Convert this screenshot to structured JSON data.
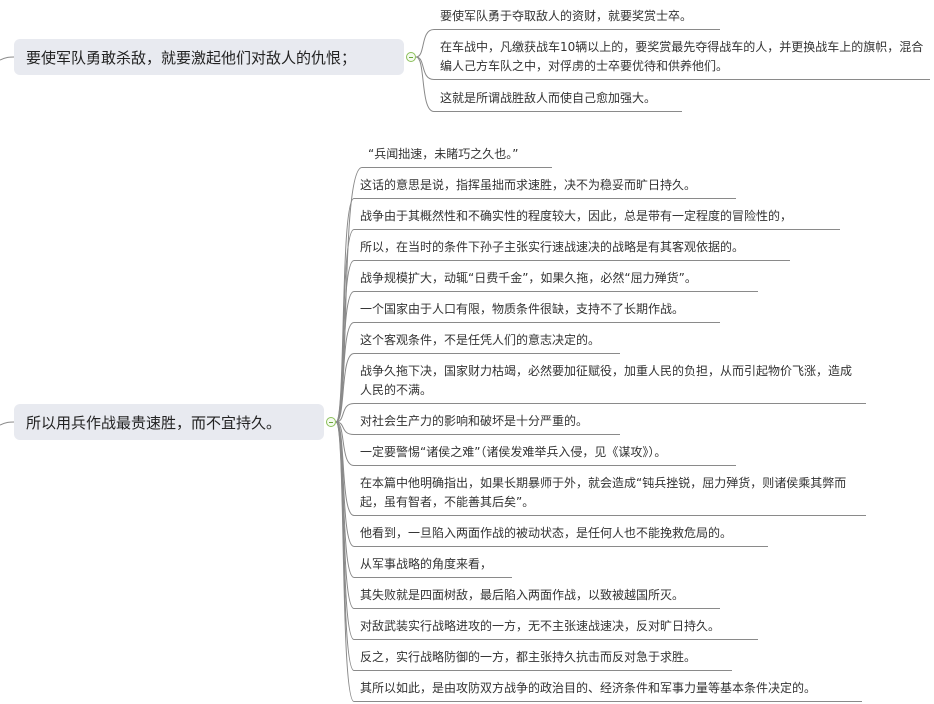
{
  "branches": [
    {
      "topic": "要使军队勇敢杀敌，就要激起他们对敌人的仇恨；",
      "leaves": [
        "要使军队勇于夺取敌人的资财，就要奖赏士卒。",
        "在车战中，凡缴获战车10辆以上的，要奖赏最先夺得战车的人，并更换战车上的旗帜，混合编人己方车队之中，对俘虏的士卒要优待和供养他们。",
        "这就是所谓战胜敌人而使自己愈加强大。"
      ]
    },
    {
      "topic": "所以用兵作战最贵速胜，而不宜持久。",
      "leaves": [
        "“兵闻拙速，未睹巧之久也。”",
        "这话的意思是说，指挥虽拙而求速胜，决不为稳妥而旷日持久。",
        "战争由于其概然性和不确实性的程度较大，因此，总是带有一定程度的冒险性的，",
        "所以，在当时的条件下孙子主张实行速战速决的战略是有其客观依据的。",
        "战争规模扩大，动辄“日费千金”，如果久拖，必然“屈力殚货”。",
        "一个国家由于人口有限，物质条件很缺，支持不了长期作战。",
        "这个客观条件，不是任凭人们的意志决定的。",
        "战争久拖下决，国家财力枯竭，必然要加征赋役，加重人民的负担，从而引起物价飞涨，造成人民的不满。",
        "对社会生产力的影响和破坏是十分严重的。",
        "一定要警惕“诸侯之难”（诸侯发难举兵入侵，见《谋攻》）。",
        "在本篇中他明确指出，如果长期暴师于外，就会造成“钝兵挫锐，屈力殚货，则诸侯乘其弊而起，虽有智者，不能善其后矣”。",
        "他看到，一旦陷入两面作战的被动状态，是任何人也不能挽救危局的。",
        "从军事战略的角度来看，",
        "其失败就是四面树敌，最后陷入两面作战，以致被越国所灭。",
        "对敌武装实行战略进攻的一方，无不主张速战速决，反对旷日持久。",
        "反之，实行战略防御的一方，都主张持久抗击而反对急于求胜。",
        "其所以如此，是由攻防双方战争的政治目的、经济条件和军事力量等基本条件决定的。"
      ]
    }
  ],
  "colors": {
    "line": "#8a8a8a",
    "topic_bg": "#e8eaf0",
    "toggle": "#8bbf5a"
  }
}
